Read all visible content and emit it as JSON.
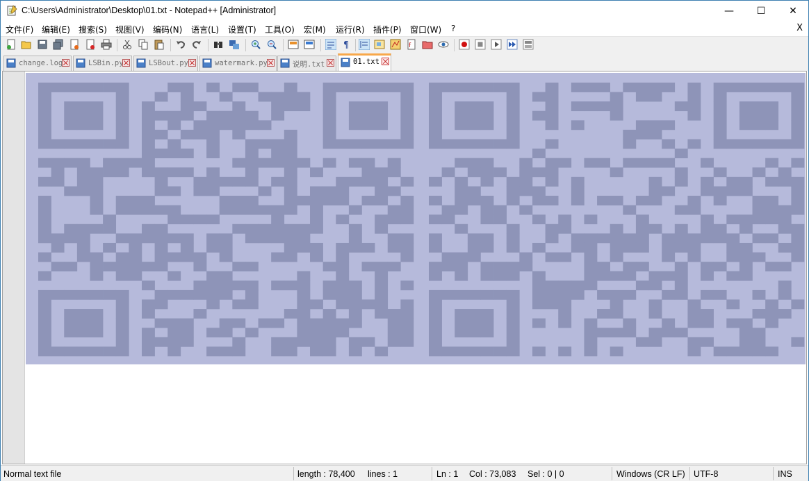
{
  "window": {
    "title": "C:\\Users\\Administrator\\Desktop\\01.txt - Notepad++ [Administrator]",
    "minimize": "—",
    "maximize": "☐",
    "close": "✕"
  },
  "menu": {
    "items": [
      "文件(F)",
      "编辑(E)",
      "搜索(S)",
      "视图(V)",
      "编码(N)",
      "语言(L)",
      "设置(T)",
      "工具(O)",
      "宏(M)",
      "运行(R)",
      "插件(P)",
      "窗口(W)",
      "?"
    ],
    "close_doc": "X"
  },
  "toolbar": {
    "icons": [
      "new-file-icon",
      "open-file-icon",
      "save-icon",
      "save-all-icon",
      "close-icon",
      "close-all-icon",
      "print-icon",
      "cut-icon",
      "copy-icon",
      "paste-icon",
      "undo-icon",
      "redo-icon",
      "find-icon",
      "replace-icon",
      "zoom-in-icon",
      "zoom-out-icon",
      "sync-vertical-icon",
      "sync-horizontal-icon",
      "word-wrap-icon",
      "show-all-chars-icon",
      "indent-guide-icon",
      "doc-map-icon",
      "function-list-icon",
      "folder-workspace-icon",
      "monitoring-icon",
      "start-recording-icon",
      "stop-recording-icon",
      "playback-icon",
      "run-macro-multiple-icon",
      "save-macro-icon"
    ]
  },
  "tabs": [
    {
      "label": "change.log",
      "active": false
    },
    {
      "label": "LSBin.py",
      "active": false
    },
    {
      "label": "LSBout.py",
      "active": false
    },
    {
      "label": "watermark.py",
      "active": false
    },
    {
      "label": "说明.txt",
      "active": false
    },
    {
      "label": "01.txt",
      "active": true
    }
  ],
  "colors": {
    "text_block": "#8e94b8",
    "text_block_light": "#b6badb",
    "active_tab_accent": "#f8a84a"
  },
  "status": {
    "filetype": "Normal text file",
    "length": "length : 78,400",
    "lines": "lines : 1",
    "ln": "Ln : 1",
    "col": "Col : 73,083",
    "sel": "Sel : 0 | 0",
    "eol": "Windows (CR LF)",
    "encoding": "UTF-8",
    "mode": "INS"
  }
}
